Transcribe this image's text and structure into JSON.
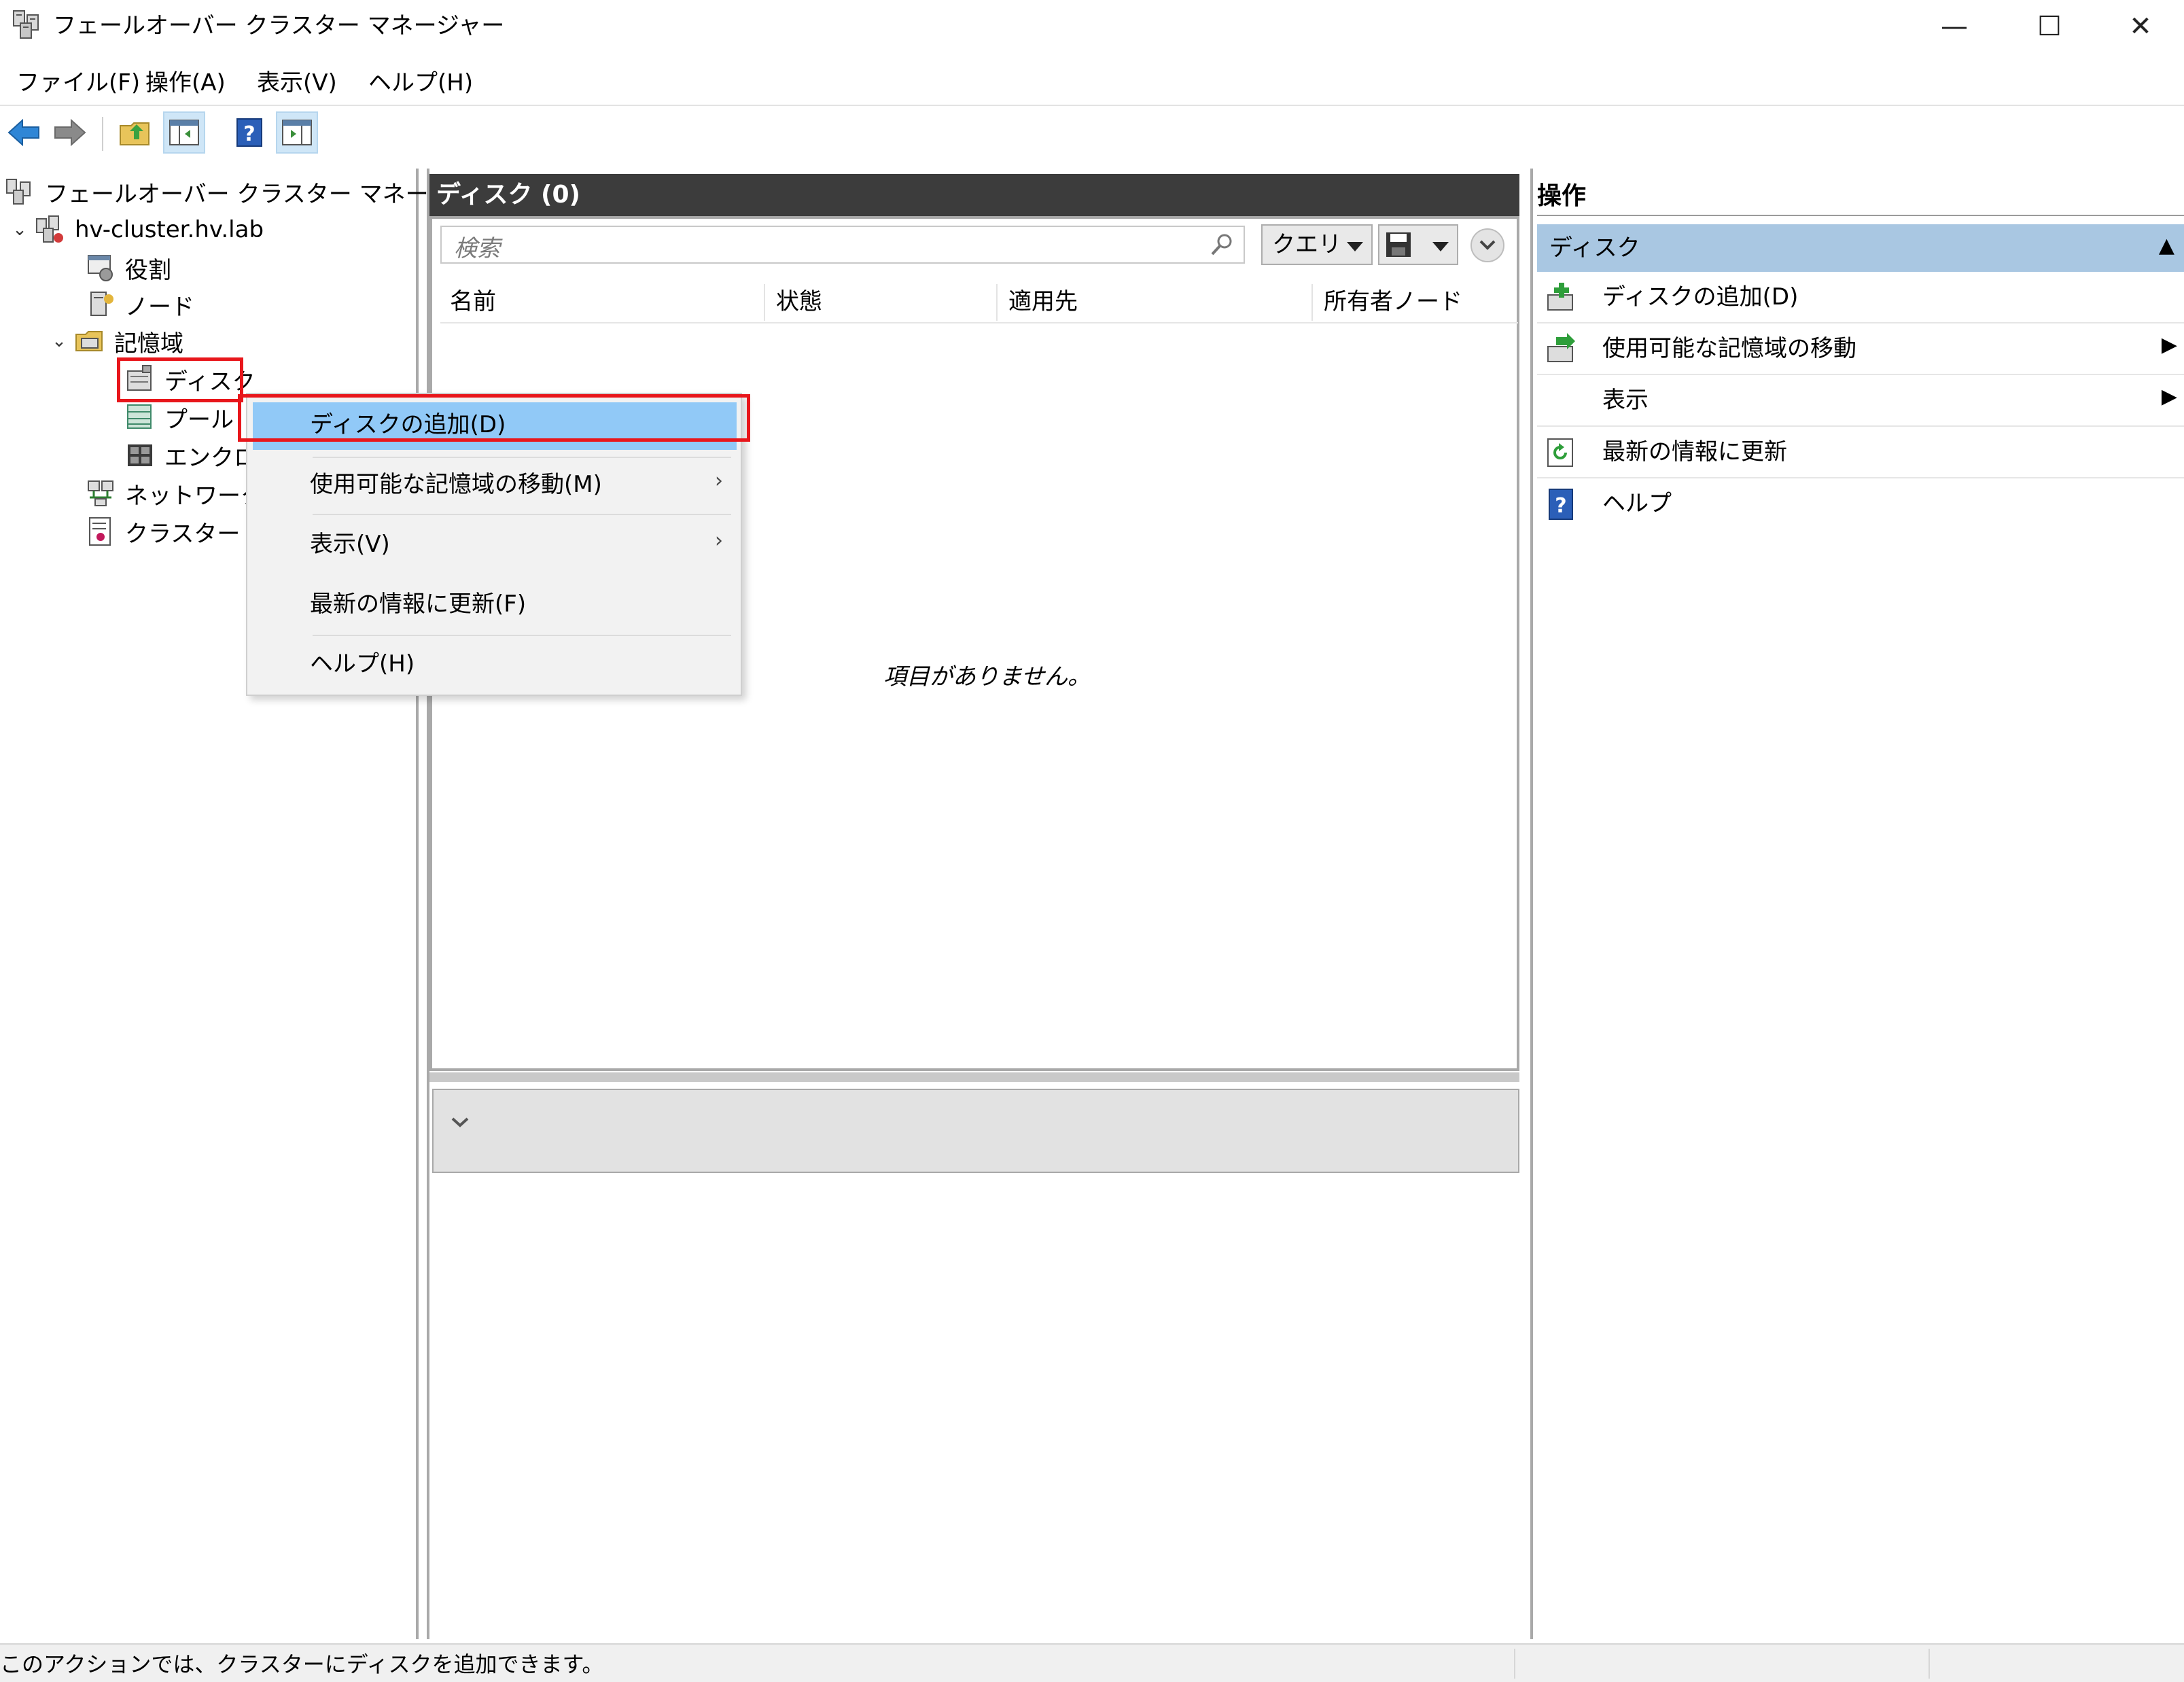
{
  "window": {
    "title": "フェールオーバー クラスター マネージャー",
    "minimize": "—",
    "maximize": "☐",
    "close": "✕"
  },
  "menubar": {
    "file": "ファイル(F)",
    "action": "操作(A)",
    "view": "表示(V)",
    "help": "ヘルプ(H)"
  },
  "tree": {
    "root": "フェールオーバー クラスター マネージャー",
    "cluster": "hv-cluster.hv.lab",
    "roles": "役割",
    "nodes": "ノード",
    "storage": "記憶域",
    "disks": "ディスク",
    "pools": "プール",
    "enclosures": "エンクロ",
    "networks": "ネットワーク",
    "cluster_events": "クラスター イ"
  },
  "center": {
    "header": "ディスク (0)",
    "search_placeholder": "検索",
    "query_label": "クエリ",
    "columns": [
      "名前",
      "状態",
      "適用先",
      "所有者ノード"
    ],
    "empty_message": "項目がありません。"
  },
  "context_menu": {
    "items": [
      {
        "label": "ディスクの追加(D)",
        "submenu": false
      },
      {
        "label": "使用可能な記憶域の移動(M)",
        "submenu": true
      },
      {
        "label": "表示(V)",
        "submenu": true
      },
      {
        "label": "最新の情報に更新(F)",
        "submenu": false
      },
      {
        "label": "ヘルプ(H)",
        "submenu": false
      }
    ]
  },
  "actions": {
    "title": "操作",
    "section": "ディスク",
    "items": [
      {
        "label": "ディスクの追加(D)",
        "icon": "add-disk-icon",
        "submenu": false
      },
      {
        "label": "使用可能な記憶域の移動",
        "icon": "move-storage-icon",
        "submenu": true
      },
      {
        "label": "表示",
        "icon": "",
        "submenu": true
      },
      {
        "label": "最新の情報に更新",
        "icon": "refresh-icon",
        "submenu": false
      },
      {
        "label": "ヘルプ",
        "icon": "help-icon",
        "submenu": false
      }
    ]
  },
  "status": {
    "text": "このアクションでは、クラスターにディスクを追加できます。"
  },
  "colors": {
    "highlight": "#91c9f7",
    "section_bg": "#a9c7e2",
    "header_bg": "#3c3c3c",
    "annotation_red": "#e8161b"
  }
}
